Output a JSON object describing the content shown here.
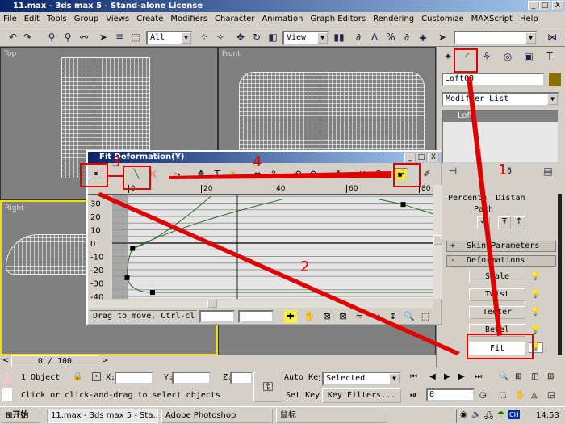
{
  "window": {
    "title": "11.max - 3ds max 5 - Stand-alone License",
    "min": "_",
    "max": "□",
    "close": "X"
  },
  "menu": [
    "File",
    "Edit",
    "Tools",
    "Group",
    "Views",
    "Create",
    "Modifiers",
    "Character",
    "Animation",
    "Graph Editors",
    "Rendering",
    "Customize",
    "MAXScript",
    "Help"
  ],
  "toolbar": {
    "selection_filter": "All",
    "ref_coord": "View",
    "named_selection": ""
  },
  "viewports": {
    "top": "Top",
    "front": "Front",
    "right": "Right",
    "perspective": ""
  },
  "panel": {
    "object_name": "Loft03",
    "object_color": "#8b7000",
    "modifier_list": "Modifier List",
    "stack_item": "Loft",
    "path_params": {
      "percentage": "Percenta",
      "distance": "Distan",
      "path_steps": "Path"
    },
    "rollouts": {
      "skin": "Skin Parameters",
      "skin_sign": "+",
      "deform": "Deformations",
      "deform_sign": "-"
    },
    "deform_buttons": [
      "Scale",
      "Twist",
      "Teeter",
      "Bevel",
      "Fit"
    ]
  },
  "dialog": {
    "title": "Fit Deformation(Y)",
    "ruler": [
      "0",
      "20",
      "40",
      "60",
      "80"
    ],
    "y_labels": [
      "30",
      "20",
      "10",
      "0",
      "-10",
      "-20",
      "-30",
      "-40"
    ],
    "status": "Drag to move. Ctrl-cl",
    "field1": "",
    "field2": "",
    "curve_points": [
      [
        0.5,
        -4
      ],
      [
        -1,
        -26
      ],
      [
        6,
        -37
      ],
      [
        75,
        29
      ]
    ]
  },
  "time": {
    "slider": "0 / 100",
    "prev": "<",
    "next": ">"
  },
  "status": {
    "selection": "1 Object",
    "x_label": "X:",
    "y_label": "Y:",
    "z_label": "Z:",
    "x": "",
    "y": "",
    "z": "",
    "prompt": "Click or click-and-drag to select objects",
    "auto_key": "Auto Key",
    "set_key": "Set Key",
    "selected": "Selected",
    "key_filters": "Key Filters...",
    "frame": "0"
  },
  "taskbar": {
    "start": "开始",
    "items": [
      "11.max - 3ds max 5 - Sta...",
      "Adobe Photoshop",
      "鼠标"
    ],
    "lang": "CH",
    "clock": "14:53"
  },
  "annotations": [
    "1",
    "2",
    "3",
    "4"
  ],
  "annotation_color": "#e00000"
}
